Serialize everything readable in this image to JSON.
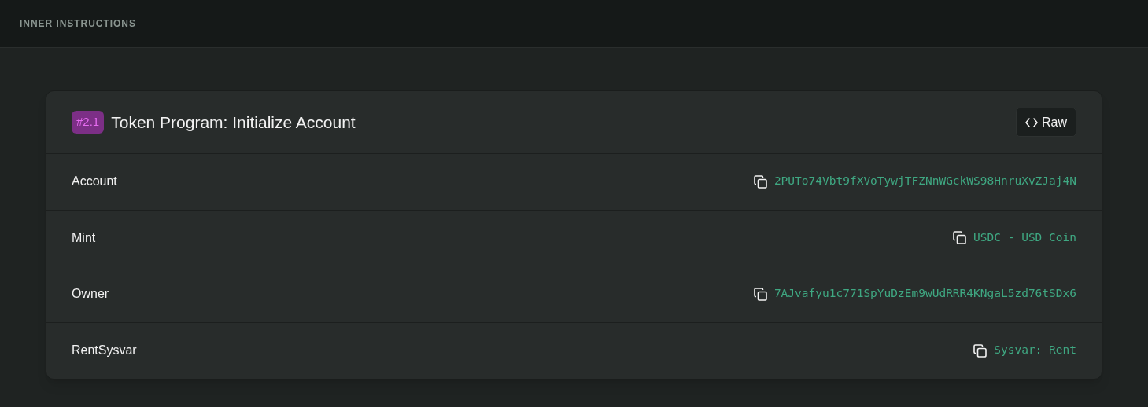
{
  "section_title": "INNER INSTRUCTIONS",
  "card": {
    "badge": "#2.1",
    "title": "Token Program: Initialize Account",
    "raw_button": "Raw",
    "rows": [
      {
        "label": "Account",
        "value": "2PUTo74Vbt9fXVoTywjTFZNnWGckWS98HnruXvZJaj4N"
      },
      {
        "label": "Mint",
        "value": "USDC - USD Coin"
      },
      {
        "label": "Owner",
        "value": "7AJvafyu1c771SpYuDzEm9wUdRRR4KNgaL5zd76tSDx6"
      },
      {
        "label": "RentSysvar",
        "value": "Sysvar: Rent"
      }
    ]
  }
}
